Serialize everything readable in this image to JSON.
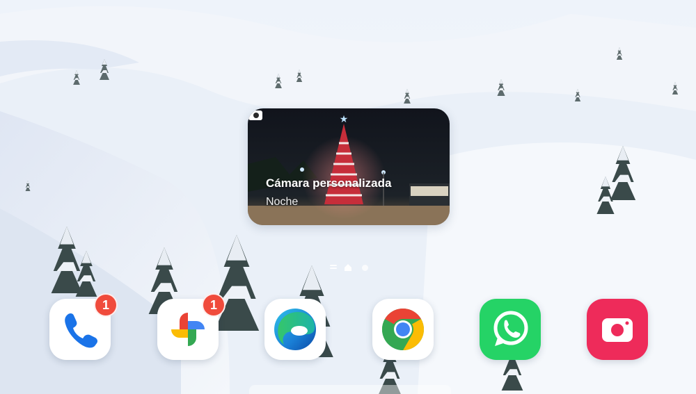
{
  "widget": {
    "title": "Cámara personalizada",
    "subtitle": "Noche",
    "icon": "camera-icon"
  },
  "page_indicator": {
    "pages": [
      "list",
      "home",
      "page"
    ],
    "active": "home"
  },
  "dock": {
    "apps": [
      {
        "name": "Teléfono",
        "icon": "phone-icon",
        "badge": "1"
      },
      {
        "name": "Google Fotos",
        "icon": "photos-pinwheel-icon",
        "badge": "1"
      },
      {
        "name": "Microsoft Edge",
        "icon": "edge-icon",
        "badge": ""
      },
      {
        "name": "Chrome",
        "icon": "chrome-icon",
        "badge": ""
      },
      {
        "name": "WhatsApp",
        "icon": "whatsapp-icon",
        "badge": ""
      },
      {
        "name": "Cámara",
        "icon": "camera-icon",
        "badge": ""
      }
    ]
  },
  "colors": {
    "badge": "#f04b3c",
    "whatsapp": "#25d366",
    "camera_app": "#ee2b5a",
    "phone": "#1a73e8"
  }
}
